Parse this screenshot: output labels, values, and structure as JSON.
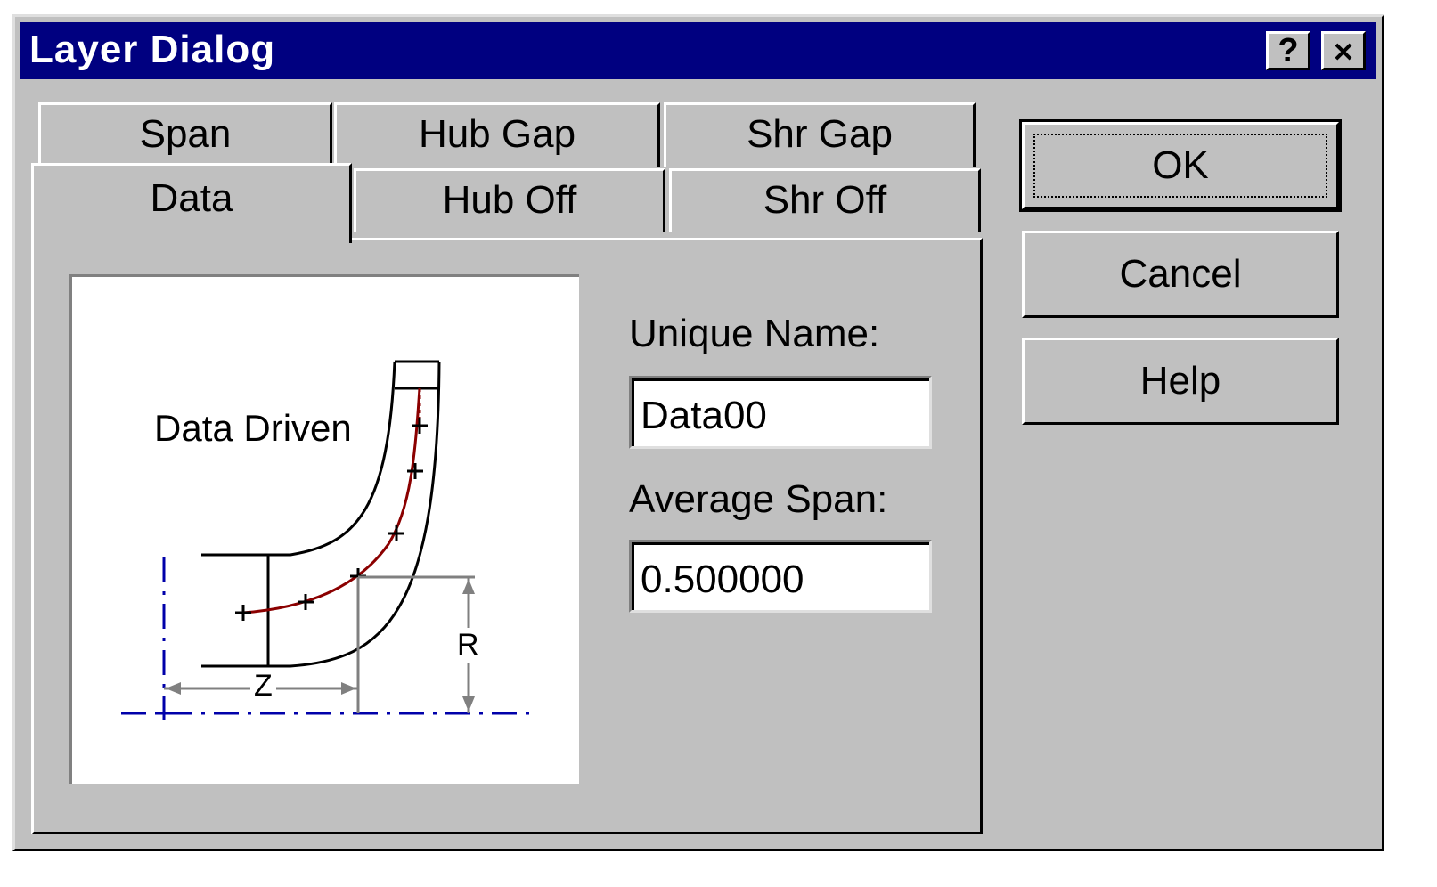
{
  "window": {
    "title": "Layer Dialog",
    "help_glyph": "?",
    "close_glyph": "✕"
  },
  "tabs": {
    "row1": [
      {
        "label": "Span"
      },
      {
        "label": "Hub Gap"
      },
      {
        "label": "Shr Gap"
      }
    ],
    "row2": [
      {
        "label": "Data",
        "active": true
      },
      {
        "label": "Hub Off"
      },
      {
        "label": "Shr Off"
      }
    ]
  },
  "diagram": {
    "caption": "Data Driven",
    "z_label": "Z",
    "r_label": "R"
  },
  "form": {
    "unique_name_label": "Unique Name:",
    "unique_name_value": "Data00",
    "average_span_label": "Average Span:",
    "average_span_value": "0.500000"
  },
  "buttons": {
    "ok": "OK",
    "cancel": "Cancel",
    "help": "Help"
  },
  "colors": {
    "titlebar": "#000080",
    "face": "#c0c0c0",
    "axis_line": "#0000aa",
    "mean_line": "#8b0000",
    "dimension": "#808080"
  }
}
